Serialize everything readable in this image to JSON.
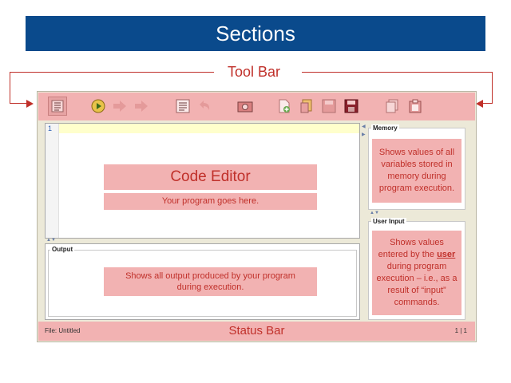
{
  "slide": {
    "title": "Sections",
    "toolbar_caption": "Tool Bar",
    "accent_color": "#c0302a",
    "banner_color": "#0a4a8c",
    "highlight_color": "#f2b2b2"
  },
  "toolbar": {
    "buttons": [
      {
        "icon": "code-view-icon"
      },
      {
        "icon": "run-icon"
      },
      {
        "icon": "step-icon"
      },
      {
        "icon": "step-over-icon"
      },
      {
        "icon": "list-icon"
      },
      {
        "icon": "undo-icon"
      },
      {
        "icon": "camera-icon"
      },
      {
        "icon": "new-file-icon"
      },
      {
        "icon": "open-file-icon"
      },
      {
        "icon": "save-icon"
      },
      {
        "icon": "save-as-icon"
      },
      {
        "icon": "copy-icon"
      },
      {
        "icon": "paste-icon"
      }
    ]
  },
  "editor": {
    "line_number": "1",
    "title": "Code Editor",
    "subtitle": "Your program goes here."
  },
  "output": {
    "legend": "Output",
    "description": "Shows all output produced by your program during execution."
  },
  "memory": {
    "legend": "Memory",
    "description": "Shows values of all variables stored in memory during program execution."
  },
  "user_input": {
    "legend": "User Input",
    "desc_before": "Shows values entered by the ",
    "desc_emph": "user",
    "desc_after": " during program execution – i.e., as a result of “input” commands."
  },
  "status": {
    "file": "File: Untitled",
    "caption": "Status Bar",
    "page": "1 | 1"
  }
}
